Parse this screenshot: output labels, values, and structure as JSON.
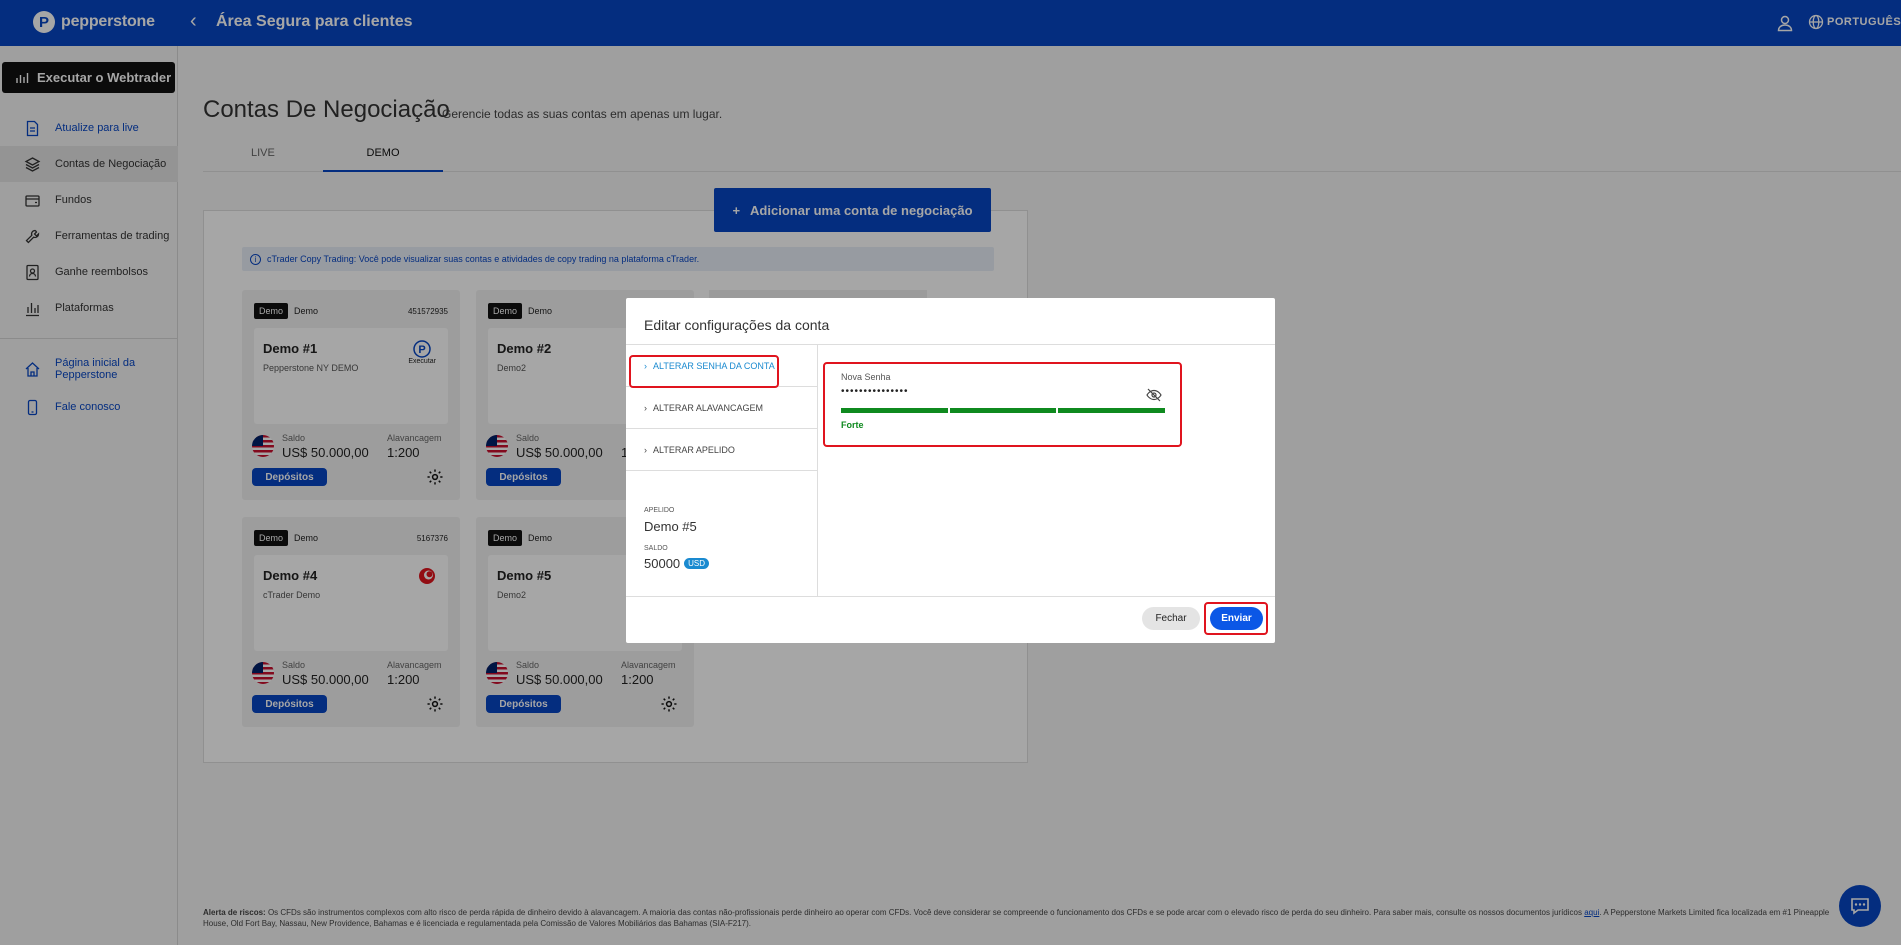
{
  "brand": {
    "name": "pepperstone"
  },
  "header": {
    "title": "Área Segura para clientes",
    "language": "PORTUGUÊS"
  },
  "sidebar": {
    "webtrader": "Executar o Webtrader",
    "items": [
      {
        "label": "Atualize para live",
        "icon": "document-icon"
      },
      {
        "label": "Contas de Negociação",
        "icon": "layers-icon"
      },
      {
        "label": "Fundos",
        "icon": "wallet-icon"
      },
      {
        "label": "Ferramentas de trading",
        "icon": "wrench-icon"
      },
      {
        "label": "Ganhe reembolsos",
        "icon": "badge-icon"
      },
      {
        "label": "Plataformas",
        "icon": "bar-chart-icon"
      }
    ],
    "secondary": [
      {
        "label": "Página inicial da Pepperstone",
        "icon": "home-icon"
      },
      {
        "label": "Fale conosco",
        "icon": "phone-icon"
      }
    ]
  },
  "page": {
    "title": "Contas De Negociação",
    "subtitle": "Gerencie todas as suas contas em apenas um lugar.",
    "tabs": [
      "LIVE",
      "DEMO"
    ],
    "add_account": "Adicionar uma conta de negociação",
    "copy_banner": "cTrader Copy Trading: Você pode visualizar suas contas e atividades de copy trading na plataforma cTrader."
  },
  "cards": [
    {
      "badge": "Demo",
      "type": "Demo",
      "number": "451572935",
      "name": "Demo #1",
      "server": "Pepperstone NY DEMO",
      "platform_label": "Executar",
      "balance_label": "Saldo",
      "balance": "US$ 50.000,00",
      "leverage_label": "Alavancagem",
      "leverage": "1:200",
      "deposit": "Depósitos"
    },
    {
      "badge": "Demo",
      "type": "Demo",
      "number": "",
      "name": "Demo #2",
      "server": "Demo2",
      "balance_label": "Saldo",
      "balance": "US$ 50.000,00",
      "leverage_label": "Alavancagem",
      "leverage": "1",
      "deposit": "Depósitos"
    },
    {
      "badge": "Demo",
      "type": "Demo",
      "number": "5167376",
      "name": "Demo #4",
      "server": "cTrader Demo",
      "balance_label": "Saldo",
      "balance": "US$ 50.000,00",
      "leverage_label": "Alavancagem",
      "leverage": "1:200",
      "deposit": "Depósitos"
    },
    {
      "badge": "Demo",
      "type": "Demo",
      "number": "",
      "name": "Demo #5",
      "server": "Demo2",
      "balance_label": "Saldo",
      "balance": "US$ 50.000,00",
      "leverage_label": "Alavancagem",
      "leverage": "1:200",
      "deposit": "Depósitos"
    }
  ],
  "modal": {
    "title": "Editar configurações da conta",
    "menu": [
      "ALTERAR SENHA DA CONTA",
      "ALTERAR ALAVANCAGEM",
      "ALTERAR APELIDO"
    ],
    "nickname_label": "APELIDO",
    "nickname": "Demo #5",
    "balance_label": "SALDO",
    "balance": "50000",
    "currency": "USD",
    "password_label": "Nova Senha",
    "password_value": "•••••••••••••••",
    "strength": "Forte",
    "close": "Fechar",
    "submit": "Enviar"
  },
  "footer": {
    "risk_title": "Alerta de riscos:",
    "risk_text": "Os CFDs são instrumentos complexos com alto risco de perda rápida de dinheiro devido à alavancagem. A maioria das contas não-profissionais perde dinheiro ao operar com CFDs. Você deve considerar se compreende o funcionamento dos CFDs e se pode arcar com o elevado risco de perda do seu dinheiro. Para saber mais, consulte os nossos documentos jurídicos",
    "link": "aqui",
    "risk_text_2": ". A Pepperstone Markets Limited fica localizada em #1 Pineapple House, Old Fort Bay, Nassau, New Providence, Bahamas e é licenciada e regulamentada pela Comissão de Valores Mobiliários das Bahamas (SIA-F217)."
  },
  "colors": {
    "brand_blue": "#0746c4",
    "strong_green": "#0f8a1f",
    "highlight_red": "#e0141e"
  }
}
